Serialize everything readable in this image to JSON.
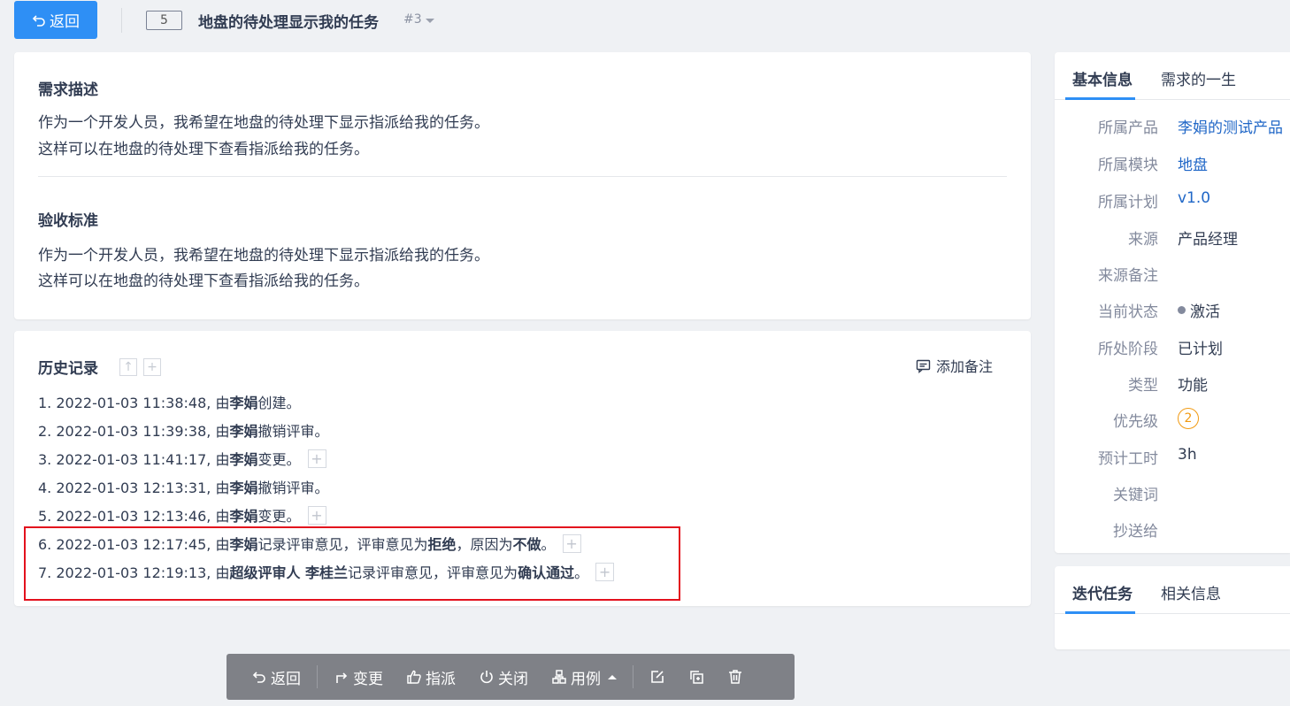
{
  "header": {
    "back_label": "返回",
    "story_id": "5",
    "title": "地盘的待处理显示我的任务",
    "version": "#3"
  },
  "description": {
    "title": "需求描述",
    "lines": [
      "作为一个开发人员，我希望在地盘的待处理下显示指派给我的任务。",
      "这样可以在地盘的待处理下查看指派给我的任务。"
    ]
  },
  "acceptance": {
    "title": "验收标准",
    "lines": [
      "作为一个开发人员，我希望在地盘的待处理下显示指派给我的任务。",
      "这样可以在地盘的待处理下查看指派给我的任务。"
    ]
  },
  "history": {
    "title": "历史记录",
    "add_note": "添加备注",
    "entries": [
      {
        "prefix": "1. 2022-01-03 11:38:48, 由 ",
        "actor": "李娟",
        "text": " 创建。",
        "has_detail": false
      },
      {
        "prefix": "2. 2022-01-03 11:39:38, 由 ",
        "actor": "李娟",
        "text": " 撤销评审。",
        "has_detail": false
      },
      {
        "prefix": "3. 2022-01-03 11:41:17, 由 ",
        "actor": "李娟",
        "text": " 变更。",
        "has_detail": true
      },
      {
        "prefix": "4. 2022-01-03 12:13:31, 由 ",
        "actor": "李娟",
        "text": " 撤销评审。",
        "has_detail": false
      },
      {
        "prefix": "5. 2022-01-03 12:13:46, 由 ",
        "actor": "李娟",
        "text": " 变更。",
        "has_detail": true
      },
      {
        "prefix": "6. 2022-01-03 12:17:45, 由 ",
        "actor": "李娟",
        "text": " 记录评审意见，评审意见为 ",
        "result": "拒绝",
        "text2": "，原因为 ",
        "reason": "不做",
        "text3": "。",
        "has_detail": true
      },
      {
        "prefix": "7. 2022-01-03 12:19:13, 由 ",
        "actor": "超级评审人 李桂兰",
        "text": " 记录评审意见，评审意见为 ",
        "result": "确认通过",
        "text2": "。",
        "has_detail": true
      }
    ]
  },
  "info": {
    "tabs": [
      "基本信息",
      "需求的一生"
    ],
    "fields": [
      {
        "label": "所属产品",
        "value": "李娟的测试产品",
        "link": true
      },
      {
        "label": "所属模块",
        "value": "地盘",
        "link": true
      },
      {
        "label": "所属计划",
        "value": "v1.0",
        "link": true
      },
      {
        "label": "来源",
        "value": "产品经理",
        "link": false
      },
      {
        "label": "来源备注",
        "value": "",
        "link": false
      },
      {
        "label": "当前状态",
        "value": "激活",
        "link": false
      },
      {
        "label": "所处阶段",
        "value": "已计划",
        "link": false
      },
      {
        "label": "类型",
        "value": "功能",
        "link": false
      },
      {
        "label": "优先级",
        "value": "2",
        "link": false
      },
      {
        "label": "预计工时",
        "value": "3h",
        "link": false
      },
      {
        "label": "关键词",
        "value": "",
        "link": false
      },
      {
        "label": "抄送给",
        "value": "",
        "link": false
      }
    ]
  },
  "iteration": {
    "tabs": [
      "迭代任务",
      "相关信息"
    ]
  },
  "toolbar": {
    "back": "返回",
    "change": "变更",
    "assign": "指派",
    "close": "关闭",
    "cases": "用例"
  },
  "colors": {
    "primary": "#2e8ff5",
    "highlight": "#e3111d",
    "priority": "#f19a12"
  }
}
